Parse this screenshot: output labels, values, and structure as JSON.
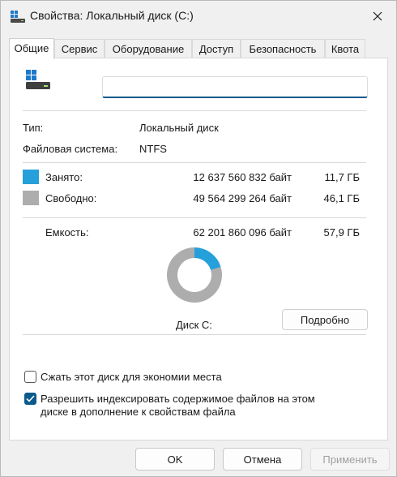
{
  "window": {
    "title": "Свойства: Локальный диск (C:)",
    "close_icon": "close-icon",
    "title_icon": "drive-icon"
  },
  "tabs": [
    {
      "label": "Общие",
      "active": true
    },
    {
      "label": "Сервис",
      "active": false
    },
    {
      "label": "Оборудование",
      "active": false
    },
    {
      "label": "Доступ",
      "active": false
    },
    {
      "label": "Безопасность",
      "active": false
    },
    {
      "label": "Квота",
      "active": false
    }
  ],
  "general": {
    "drive_name_value": "",
    "type_label": "Тип:",
    "type_value": "Локальный диск",
    "fs_label": "Файловая система:",
    "fs_value": "NTFS",
    "used": {
      "label": "Занято:",
      "bytes": "12 637 560 832 байт",
      "size": "11,7 ГБ",
      "color": "#26a0da"
    },
    "free": {
      "label": "Свободно:",
      "bytes": "49 564 299 264 байт",
      "size": "46,1 ГБ",
      "color": "#adadad"
    },
    "capacity": {
      "label": "Емкость:",
      "bytes": "62 201 860 096 байт",
      "size": "57,9 ГБ"
    },
    "disk_label": "Диск C:",
    "details_button": "Подробно",
    "compress_label": "Сжать этот диск для экономии места",
    "compress_checked": false,
    "index_label_line1": "Разрешить индексировать содержимое файлов на этом",
    "index_label_line2": "диске в дополнение к свойствам файла",
    "index_checked": true
  },
  "chart_data": {
    "type": "pie",
    "categories": [
      "Занято",
      "Свободно"
    ],
    "values": [
      12637560832,
      49564299264
    ],
    "colors": [
      "#26a0da",
      "#adadad"
    ]
  },
  "buttons": {
    "ok": "OK",
    "cancel": "Отмена",
    "apply": "Применить",
    "apply_enabled": false
  }
}
